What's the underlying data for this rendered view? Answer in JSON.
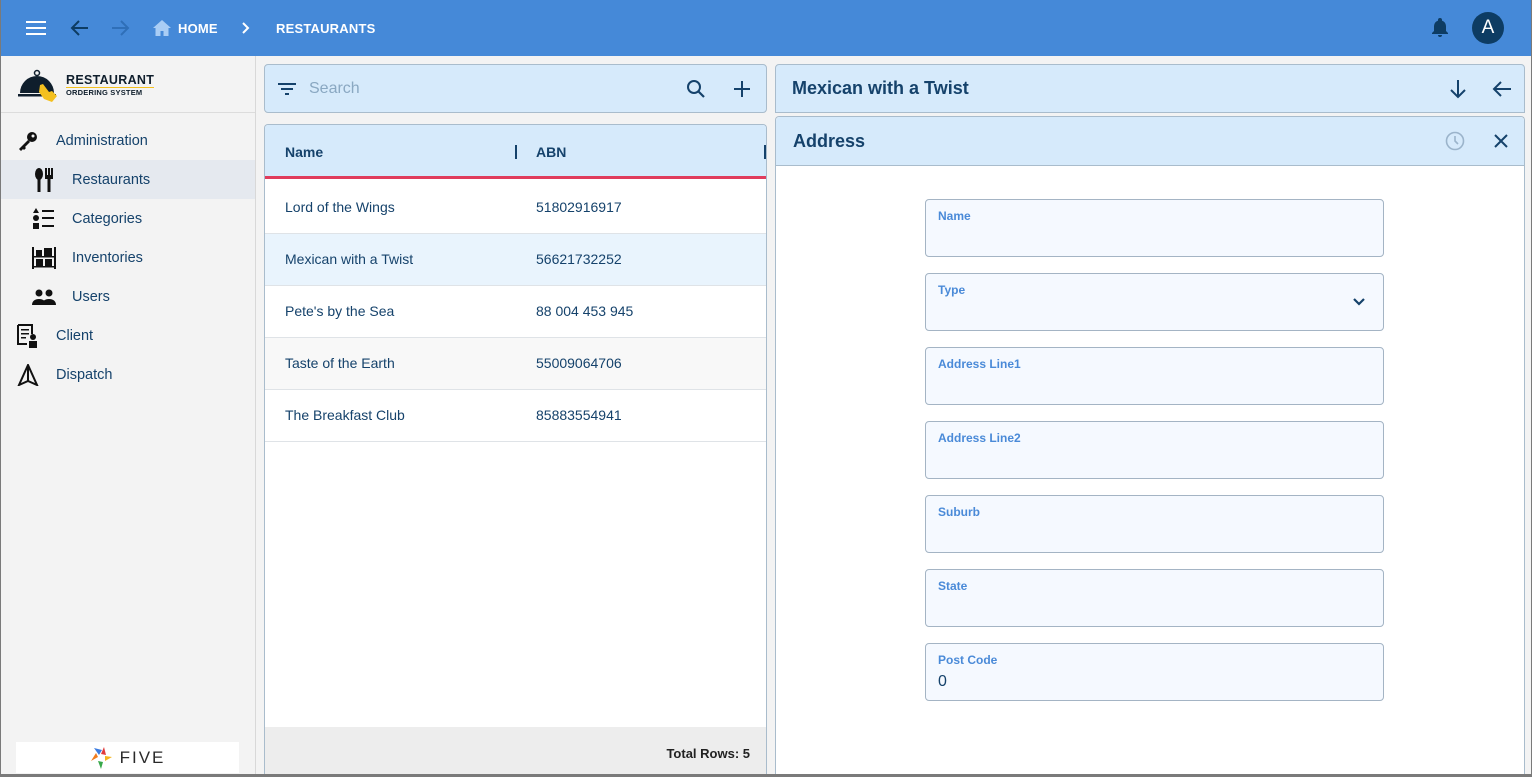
{
  "topbar": {
    "menu_icon": "menu-icon",
    "back_icon": "arrow-back-icon",
    "forward_icon": "arrow-forward-icon",
    "breadcrumb": [
      {
        "label": "HOME",
        "icon": "home-icon"
      },
      {
        "label": "RESTAURANTS"
      }
    ],
    "notifications_icon": "bell-icon",
    "avatar_initial": "A",
    "colors": {
      "bar": "#4589d8",
      "avatar": "#0d3c63"
    }
  },
  "sidebar": {
    "logo": {
      "line1": "RESTAURANT",
      "line2": "ORDERING SYSTEM"
    },
    "items": [
      {
        "label": "Administration",
        "icon": "key-icon",
        "level": 0
      },
      {
        "label": "Restaurants",
        "icon": "cutlery-icon",
        "level": 1,
        "active": true
      },
      {
        "label": "Categories",
        "icon": "category-list-icon",
        "level": 1
      },
      {
        "label": "Inventories",
        "icon": "warehouse-shelf-icon",
        "level": 1
      },
      {
        "label": "Users",
        "icon": "users-icon",
        "level": 1
      },
      {
        "label": "Client",
        "icon": "client-document-icon",
        "level": 0
      },
      {
        "label": "Dispatch",
        "icon": "dispatch-arrow-icon",
        "level": 0
      }
    ],
    "footer_brand": "FIVE"
  },
  "list": {
    "search_placeholder": "Search",
    "search_value": "",
    "columns": [
      "Name",
      "ABN"
    ],
    "rows": [
      {
        "name": "Lord of the Wings",
        "abn": "51802916917"
      },
      {
        "name": "Mexican with a Twist",
        "abn": "56621732252",
        "selected": true
      },
      {
        "name": "Pete's by the Sea",
        "abn": "88 004 453 945"
      },
      {
        "name": "Taste of the Earth",
        "abn": "55009064706"
      },
      {
        "name": "The Breakfast Club",
        "abn": "85883554941"
      }
    ],
    "total_rows_label": "Total Rows: 5",
    "colors": {
      "header_accent": "#e03c5c",
      "header_bg": "#d6eafb",
      "selected_row": "#e9f4fd"
    }
  },
  "detail": {
    "title": "Mexican with a Twist",
    "form": {
      "title": "Address",
      "fields": [
        {
          "label": "Name",
          "value": "",
          "type": "text"
        },
        {
          "label": "Type",
          "value": "",
          "type": "select"
        },
        {
          "label": "Address Line1",
          "value": "",
          "type": "text"
        },
        {
          "label": "Address Line2",
          "value": "",
          "type": "text"
        },
        {
          "label": "Suburb",
          "value": "",
          "type": "text"
        },
        {
          "label": "State",
          "value": "",
          "type": "text"
        },
        {
          "label": "Post Code",
          "value": "0",
          "type": "text"
        }
      ]
    }
  }
}
